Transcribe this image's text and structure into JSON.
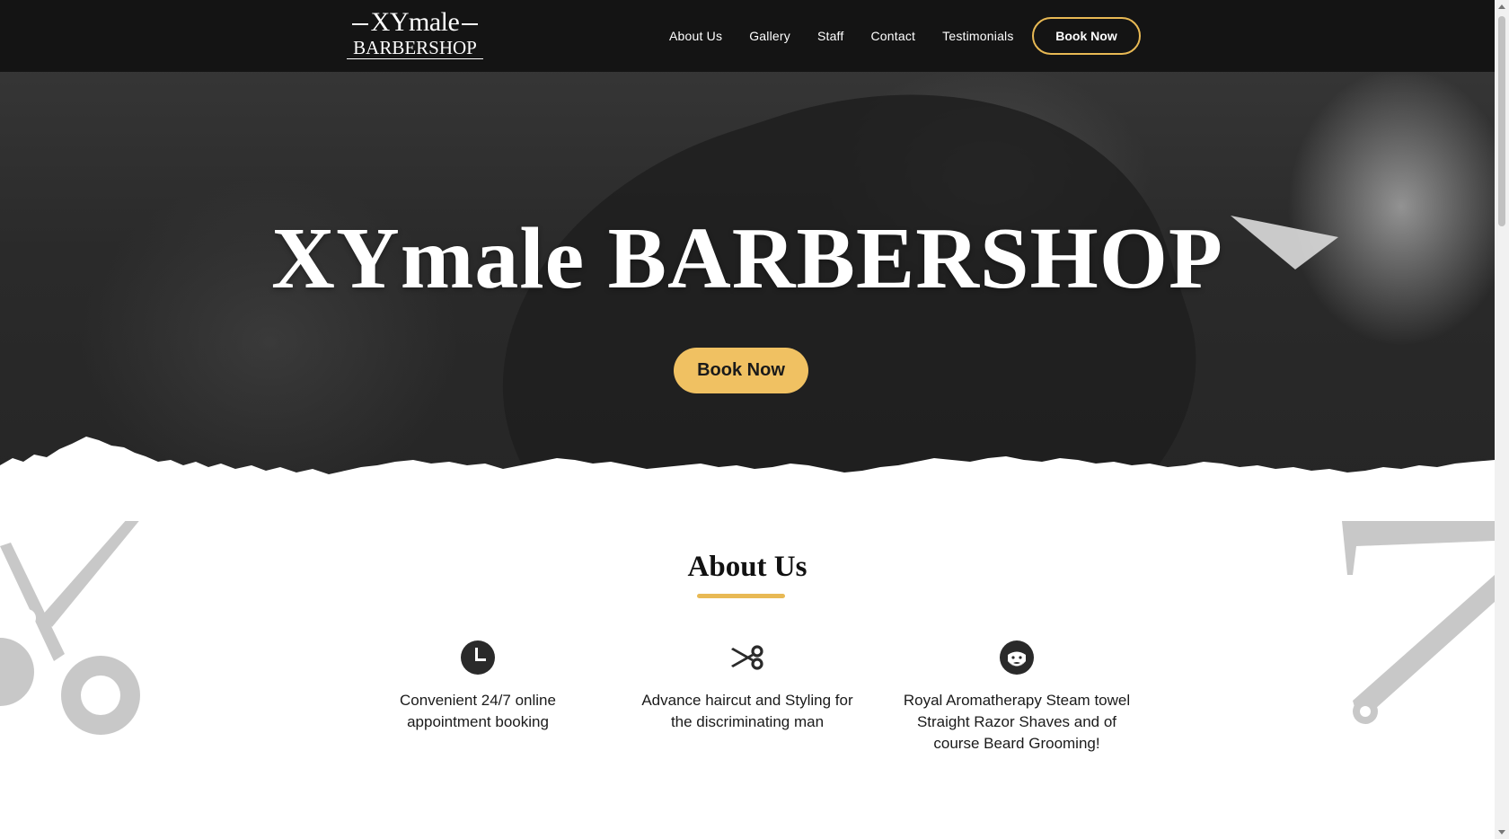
{
  "logo": {
    "line1": "XYmale",
    "line2": "BARBERSHOP"
  },
  "nav": {
    "links": [
      "About Us",
      "Gallery",
      "Staff",
      "Contact",
      "Testimonials"
    ],
    "book_label": "Book Now"
  },
  "hero": {
    "title": "XYmale BARBERSHOP",
    "button_label": "Book Now"
  },
  "about": {
    "title": "About Us",
    "features": [
      {
        "icon": "clock-icon",
        "text": "Convenient 24/7 online appointment booking"
      },
      {
        "icon": "scissors-icon",
        "text": "Advance haircut and Styling for the discriminating man"
      },
      {
        "icon": "bearded-man-icon",
        "text": "Royal Aromatherapy Steam towel Straight Razor Shaves and of course Beard Grooming!"
      }
    ]
  },
  "colors": {
    "accent": "#f0c162",
    "accent_border": "#e8b954",
    "nav_bg": "#111111",
    "text_dark": "#111111",
    "deco_gray": "#c8c8c8"
  }
}
